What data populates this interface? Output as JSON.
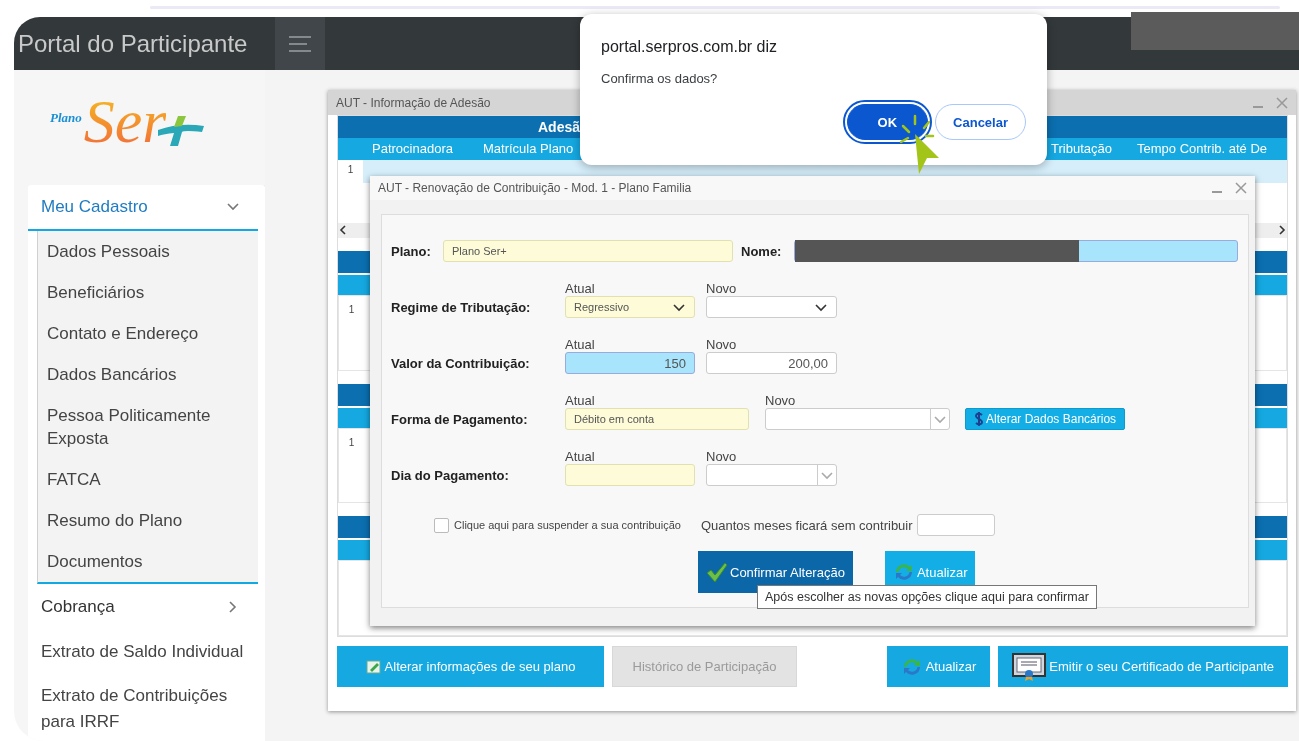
{
  "header": {
    "title": "Portal do Participante"
  },
  "logo": {
    "prefix": "Plano",
    "name": "Ser"
  },
  "sidebar": {
    "items": [
      {
        "label": "Meu Cadastro",
        "kind": "group",
        "expanded": true,
        "children": [
          {
            "label": "Dados Pessoais"
          },
          {
            "label": "Beneficiários"
          },
          {
            "label": "Contato e Endereço"
          },
          {
            "label": "Dados Bancários"
          },
          {
            "label": "Pessoa Politicamente Exposta"
          },
          {
            "label": "FATCA"
          },
          {
            "label": "Resumo do Plano"
          },
          {
            "label": "Documentos"
          }
        ]
      },
      {
        "label": "Cobrança",
        "kind": "group",
        "expanded": false
      },
      {
        "label": "Extrato de Saldo Individual",
        "kind": "link"
      },
      {
        "label": "Extrato de Contribuições para IRRF",
        "kind": "link"
      }
    ]
  },
  "adesao_window": {
    "title": "AUT - Informação de Adesão",
    "table": {
      "title": "Adesã",
      "columns": [
        "Patrocinadora",
        "Matrícula Plano",
        "Tributação",
        "Tempo Contrib. até De"
      ],
      "rows": [
        {
          "number": "1",
          "selected": true
        }
      ]
    },
    "sections": [
      {
        "kind": "rows",
        "row_number": "1"
      },
      {
        "kind": "rows",
        "row_number": "1"
      },
      {
        "kind": "blank"
      }
    ],
    "buttons": [
      {
        "label": "Alterar informações de seu plano",
        "kind": "edit",
        "disabled": false
      },
      {
        "label": "Histórico de Participação",
        "kind": "plain",
        "disabled": true
      },
      {
        "label": "Atualizar",
        "kind": "refresh",
        "disabled": false
      },
      {
        "label": "Emitir o seu Certificado de Participante",
        "kind": "certificate",
        "disabled": false
      }
    ]
  },
  "renovacao_dialog": {
    "title": "AUT - Renovação de Contribuição - Mod. 1 - Plano Familia",
    "plano": {
      "label": "Plano:",
      "value": "Plano Ser+",
      "readonly": true,
      "highlighted": false
    },
    "nome": {
      "label": "Nome:",
      "highlighted": true
    },
    "rows": [
      {
        "label": "Regime de Tributação:",
        "kind": "standard",
        "atual_label": "Atual",
        "novo_label": "Novo",
        "atual": {
          "kind": "select",
          "value": "Regressivo",
          "readonly": true,
          "highlighted": false
        },
        "novo": {
          "kind": "select",
          "readonly": false,
          "highlighted": false
        }
      },
      {
        "label": "Valor da Contribuição:",
        "kind": "standard",
        "atual_label": "Atual",
        "novo_label": "Novo",
        "atual": {
          "kind": "input",
          "value": "150",
          "highlighted": true
        },
        "novo": {
          "kind": "input",
          "value": "200,00",
          "readonly": false,
          "highlighted": false
        }
      },
      {
        "label": "Forma de Pagamento:",
        "kind": "payment",
        "atual_label": "Atual",
        "novo_label": "Novo",
        "atual": {
          "kind": "text",
          "value": "Débito em conta",
          "readonly": true,
          "highlighted": false
        },
        "novo": {
          "kind": "combo",
          "readonly": false,
          "highlighted": false
        },
        "action": "Alterar Dados Bancários"
      },
      {
        "label": "Dia do Pagamento:",
        "kind": "standard",
        "atual_label": "Atual",
        "novo_label": "Novo",
        "atual": {
          "kind": "text",
          "readonly": true,
          "highlighted": false
        },
        "novo": {
          "kind": "combo",
          "readonly": false,
          "highlighted": false
        }
      }
    ],
    "suspend": {
      "label": "Clique aqui para suspender a sua contribuição",
      "checked": false
    },
    "months": {
      "label": "Quantos meses ficará sem contribuir"
    },
    "buttons": [
      {
        "label": "Confirmar Alteração",
        "kind": "confirm"
      },
      {
        "label": "Atualizar",
        "kind": "refresh"
      }
    ],
    "tooltip": "Após escolher as novas opções clique aqui para confirmar"
  },
  "alert": {
    "title": "portal.serpros.com.br diz",
    "message": "Confirma os dados?",
    "buttons": [
      {
        "label": "OK",
        "selected": true
      },
      {
        "label": "Cancelar",
        "selected": false
      }
    ]
  }
}
